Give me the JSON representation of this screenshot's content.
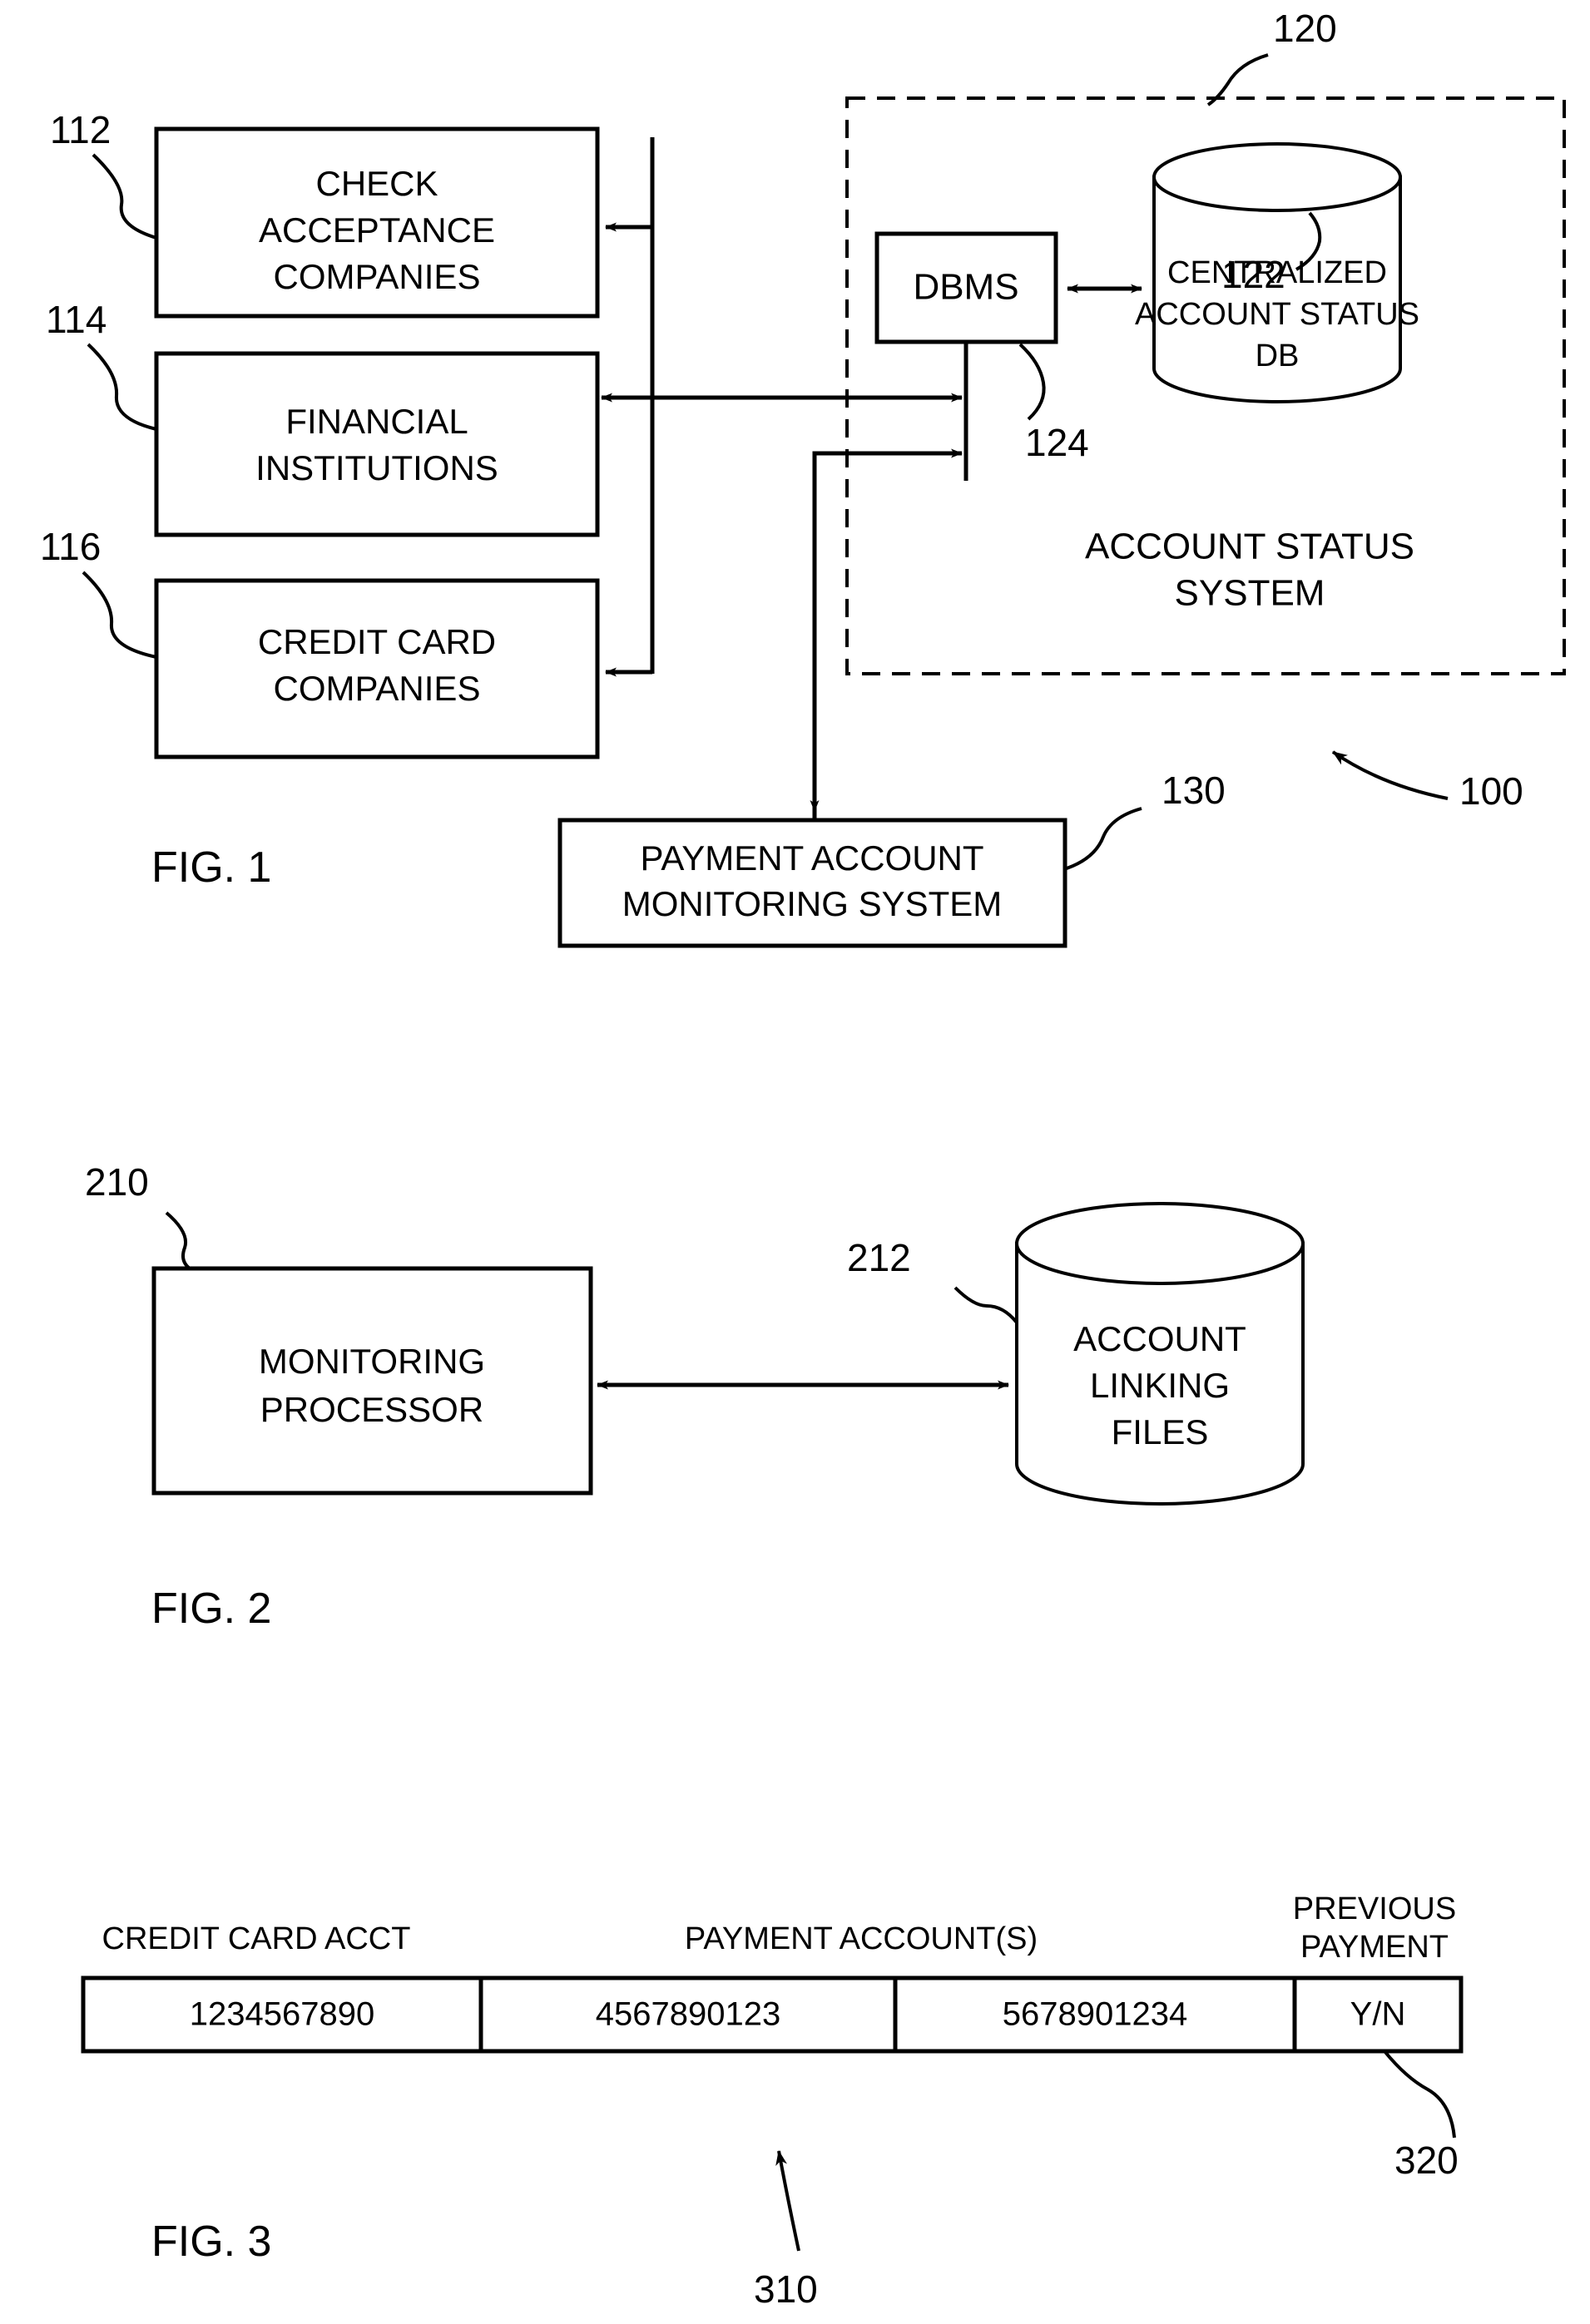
{
  "document": {
    "kind": "patent-drawing-sheet",
    "figures": [
      "FIG. 1",
      "FIG. 2",
      "FIG. 3"
    ]
  },
  "figure1": {
    "caption": "FIG. 1",
    "system_ref": "100",
    "nodes": {
      "check_acceptance": {
        "ref": "112",
        "lines": [
          "CHECK",
          "ACCEPTANCE",
          "COMPANIES"
        ]
      },
      "financial_institutions": {
        "ref": "114",
        "lines": [
          "FINANCIAL",
          "INSTITUTIONS"
        ]
      },
      "credit_card": {
        "ref": "116",
        "lines": [
          "CREDIT CARD",
          "COMPANIES"
        ]
      },
      "dbms": {
        "ref": "124",
        "lines": [
          "DBMS"
        ]
      },
      "centralized_db": {
        "ref": "122",
        "lines": [
          "CENTRALIZED",
          "ACCOUNT STATUS",
          "DB"
        ]
      },
      "payment_monitoring": {
        "ref": "130",
        "lines": [
          "PAYMENT ACCOUNT",
          "MONITORING SYSTEM"
        ]
      }
    },
    "region": {
      "ref": "120",
      "lines": [
        "ACCOUNT STATUS",
        "SYSTEM"
      ]
    }
  },
  "figure2": {
    "caption": "FIG. 2",
    "nodes": {
      "monitoring_processor": {
        "ref": "210",
        "lines": [
          "MONITORING",
          "PROCESSOR"
        ]
      },
      "account_linking_files": {
        "ref": "212",
        "lines": [
          "ACCOUNT",
          "LINKING",
          "FILES"
        ]
      }
    }
  },
  "figure3": {
    "caption": "FIG. 3",
    "record_ref": "310",
    "flag_ref": "320",
    "headers": [
      "CREDIT CARD ACCT",
      "PAYMENT ACCOUNT(S)",
      "PREVIOUS PAYMENT"
    ],
    "header_previous_payment_lines": [
      "PREVIOUS",
      "PAYMENT"
    ],
    "cells": [
      "1234567890",
      "4567890123",
      "5678901234",
      "Y/N"
    ]
  },
  "colors": {
    "ink": "#000000",
    "paper": "#ffffff"
  }
}
